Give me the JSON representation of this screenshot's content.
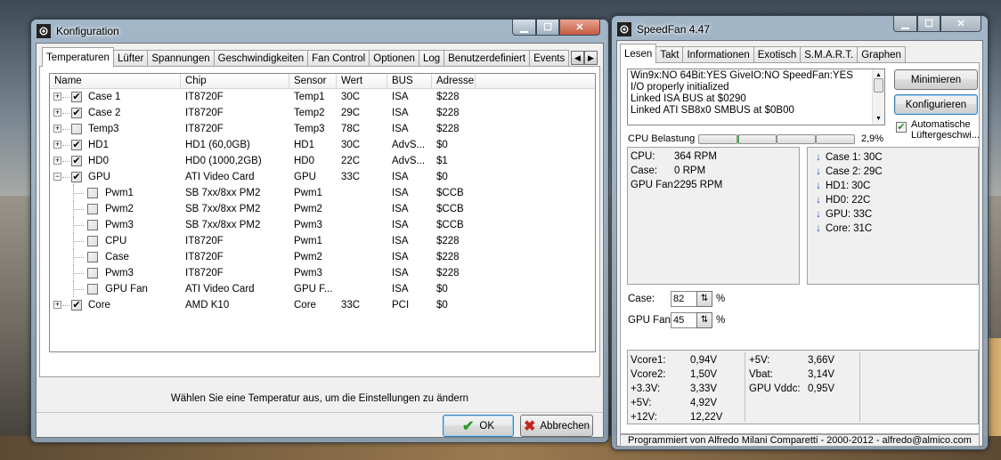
{
  "config_window": {
    "title": "Konfiguration",
    "tabs": [
      "Temperaturen",
      "Lüfter",
      "Spannungen",
      "Geschwindigkeiten",
      "Fan Control",
      "Optionen",
      "Log",
      "Benutzerdefiniert",
      "Events"
    ],
    "columns": [
      "Name",
      "Chip",
      "Sensor",
      "Wert",
      "BUS",
      "Adresse"
    ],
    "rows": [
      {
        "expand": "+",
        "checked": true,
        "name": "Case 1",
        "chip": "IT8720F",
        "sensor": "Temp1",
        "value": "30C",
        "bus": "ISA",
        "address": "$228"
      },
      {
        "expand": "+",
        "checked": true,
        "name": "Case 2",
        "chip": "IT8720F",
        "sensor": "Temp2",
        "value": "29C",
        "bus": "ISA",
        "address": "$228"
      },
      {
        "expand": "+",
        "checked": false,
        "name": "Temp3",
        "chip": "IT8720F",
        "sensor": "Temp3",
        "value": "78C",
        "bus": "ISA",
        "address": "$228"
      },
      {
        "expand": "+",
        "checked": true,
        "name": "HD1",
        "chip": "HD1 (60,0GB)",
        "sensor": "HD1",
        "value": "30C",
        "bus": "AdvS...",
        "address": "$0"
      },
      {
        "expand": "+",
        "checked": true,
        "name": "HD0",
        "chip": "HD0 (1000,2GB)",
        "sensor": "HD0",
        "value": "22C",
        "bus": "AdvS...",
        "address": "$1"
      },
      {
        "expand": "-",
        "checked": true,
        "name": "GPU",
        "chip": "ATI Video Card",
        "sensor": "GPU",
        "value": "33C",
        "bus": "ISA",
        "address": "$0"
      },
      {
        "child": true,
        "checked": false,
        "name": "Pwm1",
        "chip": "SB 7xx/8xx PM2",
        "sensor": "Pwm1",
        "value": "",
        "bus": "ISA",
        "address": "$CCB"
      },
      {
        "child": true,
        "checked": false,
        "name": "Pwm2",
        "chip": "SB 7xx/8xx PM2",
        "sensor": "Pwm2",
        "value": "",
        "bus": "ISA",
        "address": "$CCB"
      },
      {
        "child": true,
        "checked": false,
        "name": "Pwm3",
        "chip": "SB 7xx/8xx PM2",
        "sensor": "Pwm3",
        "value": "",
        "bus": "ISA",
        "address": "$CCB"
      },
      {
        "child": true,
        "checked": false,
        "name": "CPU",
        "chip": "IT8720F",
        "sensor": "Pwm1",
        "value": "",
        "bus": "ISA",
        "address": "$228"
      },
      {
        "child": true,
        "checked": false,
        "name": "Case",
        "chip": "IT8720F",
        "sensor": "Pwm2",
        "value": "",
        "bus": "ISA",
        "address": "$228"
      },
      {
        "child": true,
        "checked": false,
        "name": "Pwm3",
        "chip": "IT8720F",
        "sensor": "Pwm3",
        "value": "",
        "bus": "ISA",
        "address": "$228"
      },
      {
        "child": true,
        "checked": false,
        "name": "GPU Fan",
        "chip": "ATI Video Card",
        "sensor": "GPU F...",
        "value": "",
        "bus": "ISA",
        "address": "$0"
      },
      {
        "expand": "+",
        "checked": true,
        "name": "Core",
        "chip": "AMD K10",
        "sensor": "Core",
        "value": "33C",
        "bus": "PCI",
        "address": "$0"
      }
    ],
    "hint": "Wählen Sie eine Temperatur aus, um die Einstellungen zu ändern",
    "ok_label": "OK",
    "cancel_label": "Abbrechen"
  },
  "speedfan": {
    "title": "SpeedFan 4.47",
    "tabs": [
      "Lesen",
      "Takt",
      "Informationen",
      "Exotisch",
      "S.M.A.R.T.",
      "Graphen"
    ],
    "log_lines": [
      "Win9x:NO  64Bit:YES  GiveIO:NO  SpeedFan:YES",
      "I/O properly initialized",
      "Linked ISA BUS at $0290",
      "Linked ATI SB8x0 SMBUS at $0B00"
    ],
    "minimize_label": "Minimieren",
    "configure_label": "Konfigurieren",
    "auto_fan_label_1": "Automatische",
    "auto_fan_label_2": "Lüftergeschwi...",
    "auto_fan_checked": true,
    "cpu_load_label": "CPU Belastung",
    "cpu_load_value": "2,9%",
    "fans": [
      {
        "label": "CPU:",
        "value": "364 RPM"
      },
      {
        "label": "Case:",
        "value": "0 RPM"
      },
      {
        "label": "GPU Fan:",
        "value": "2295 RPM"
      }
    ],
    "temps": [
      {
        "label": "Case 1:",
        "value": "30C"
      },
      {
        "label": "Case 2:",
        "value": "29C"
      },
      {
        "label": "HD1:",
        "value": "30C"
      },
      {
        "label": "HD0:",
        "value": "22C"
      },
      {
        "label": "GPU:",
        "value": "33C"
      },
      {
        "label": "Core:",
        "value": "31C"
      }
    ],
    "speeds": [
      {
        "label": "Case:",
        "value": "82",
        "unit": "%"
      },
      {
        "label": "GPU Fan:",
        "value": "45",
        "unit": "%"
      }
    ],
    "volts_left": [
      {
        "label": "Vcore1:",
        "value": "0,94V"
      },
      {
        "label": "Vcore2:",
        "value": "1,50V"
      },
      {
        "label": "+3.3V:",
        "value": "3,33V"
      },
      {
        "label": "+5V:",
        "value": "4,92V"
      },
      {
        "label": "+12V:",
        "value": "12,22V"
      }
    ],
    "volts_right": [
      {
        "label": "+5V:",
        "value": "3,66V"
      },
      {
        "label": "Vbat:",
        "value": "3,14V"
      },
      {
        "label": "GPU Vddc:",
        "value": "0,95V"
      }
    ],
    "footer": "Programmiert von Alfredo Milani Comparetti - 2000-2012 - alfredo@almico.com"
  }
}
